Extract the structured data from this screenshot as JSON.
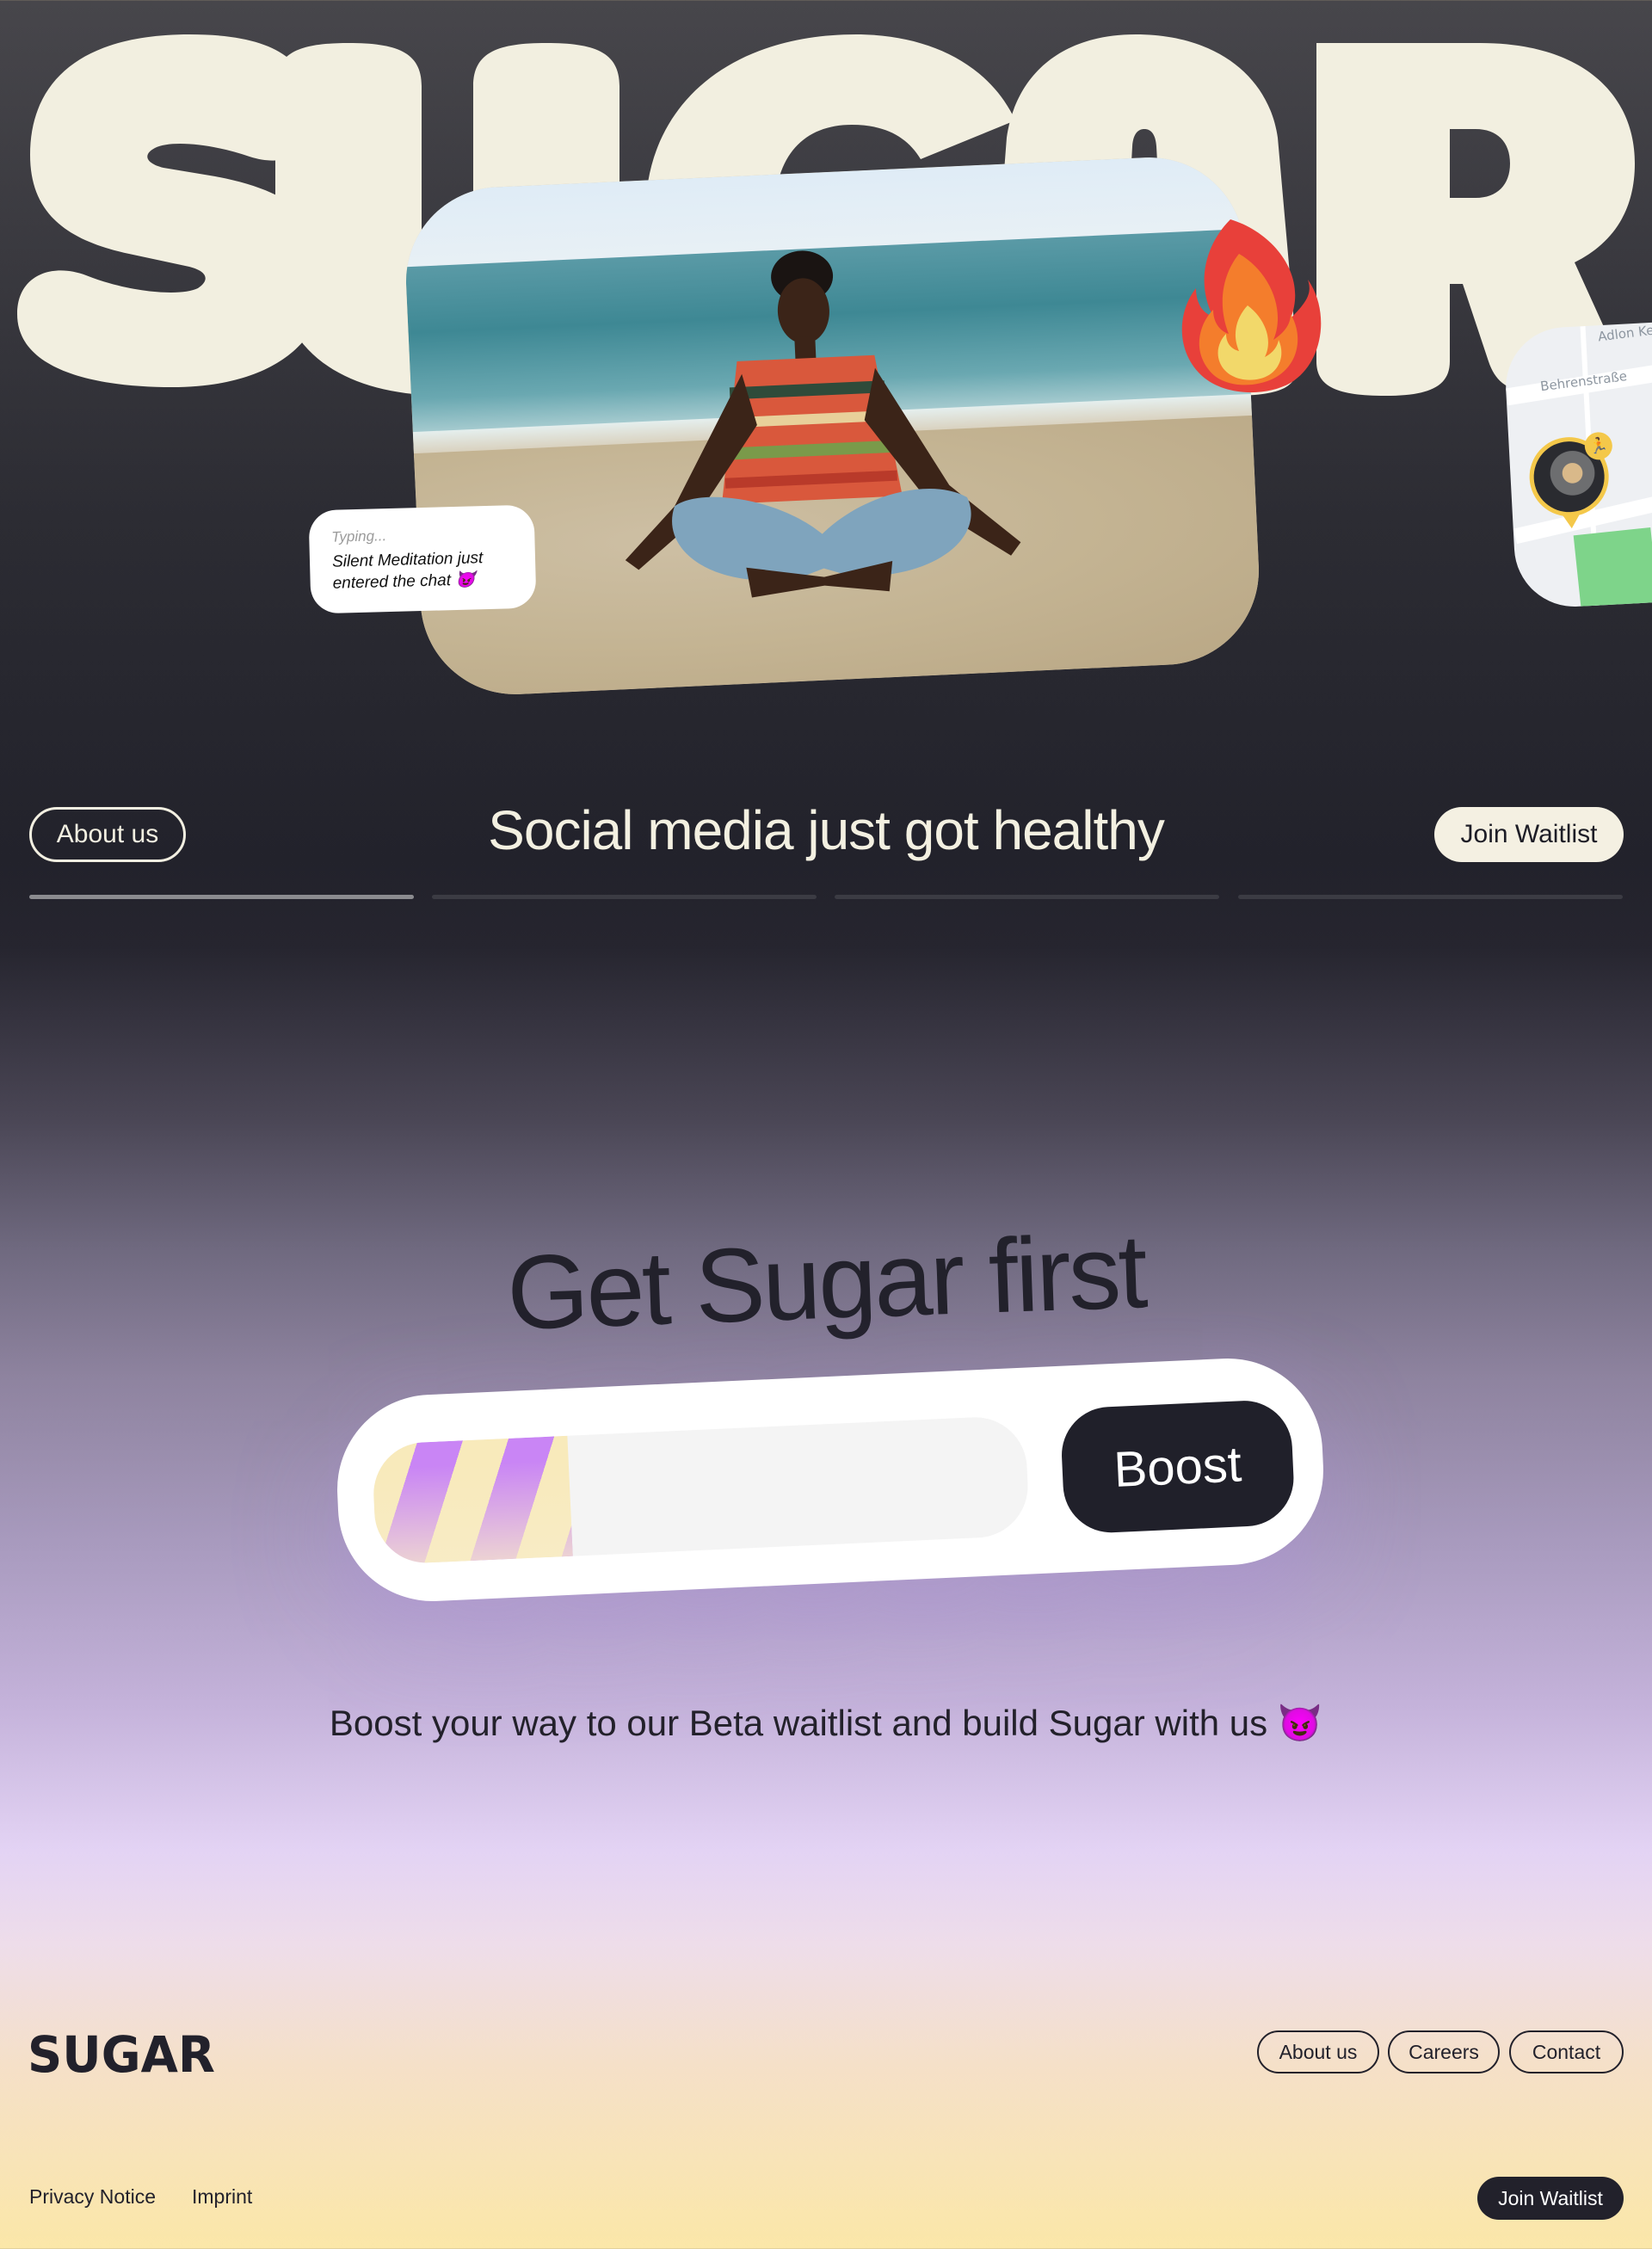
{
  "hero": {
    "wordmark": "SUGAR",
    "photo_alt": "Man meditating cross-legged on a beach",
    "sticker": "fire-emoji",
    "chat_bubble": {
      "typing": "Typing...",
      "message": "Silent Meditation just entered the chat 😈"
    },
    "map": {
      "street_top": "Adlon Ke",
      "street": "Behrenstraße",
      "activity_icon": "running-icon"
    }
  },
  "nav": {
    "about_label": "About us",
    "tagline": "Social media just got healthy",
    "join_label": "Join Waitlist",
    "slides": [
      {
        "progress": 1.0
      },
      {
        "progress": 0.0
      },
      {
        "progress": 0.0
      },
      {
        "progress": 0.0
      }
    ]
  },
  "waitlist": {
    "title": "Get Sugar first",
    "input_value": "",
    "boost_progress": 0.3,
    "boost_label": "Boost",
    "subtitle": "Boost your way to our Beta waitlist and build Sugar with us 😈"
  },
  "footer": {
    "logo": "SUGAR",
    "links": [
      "About us",
      "Careers",
      "Contact"
    ],
    "legal": [
      "Privacy Notice",
      "Imprint"
    ],
    "join_label": "Join Waitlist"
  },
  "colors": {
    "cream": "#f2efe1",
    "ink": "#22212b",
    "accent_purple": "#c985f5",
    "accent_yellow": "#f8eabb",
    "map_pin": "#f4c84a"
  }
}
